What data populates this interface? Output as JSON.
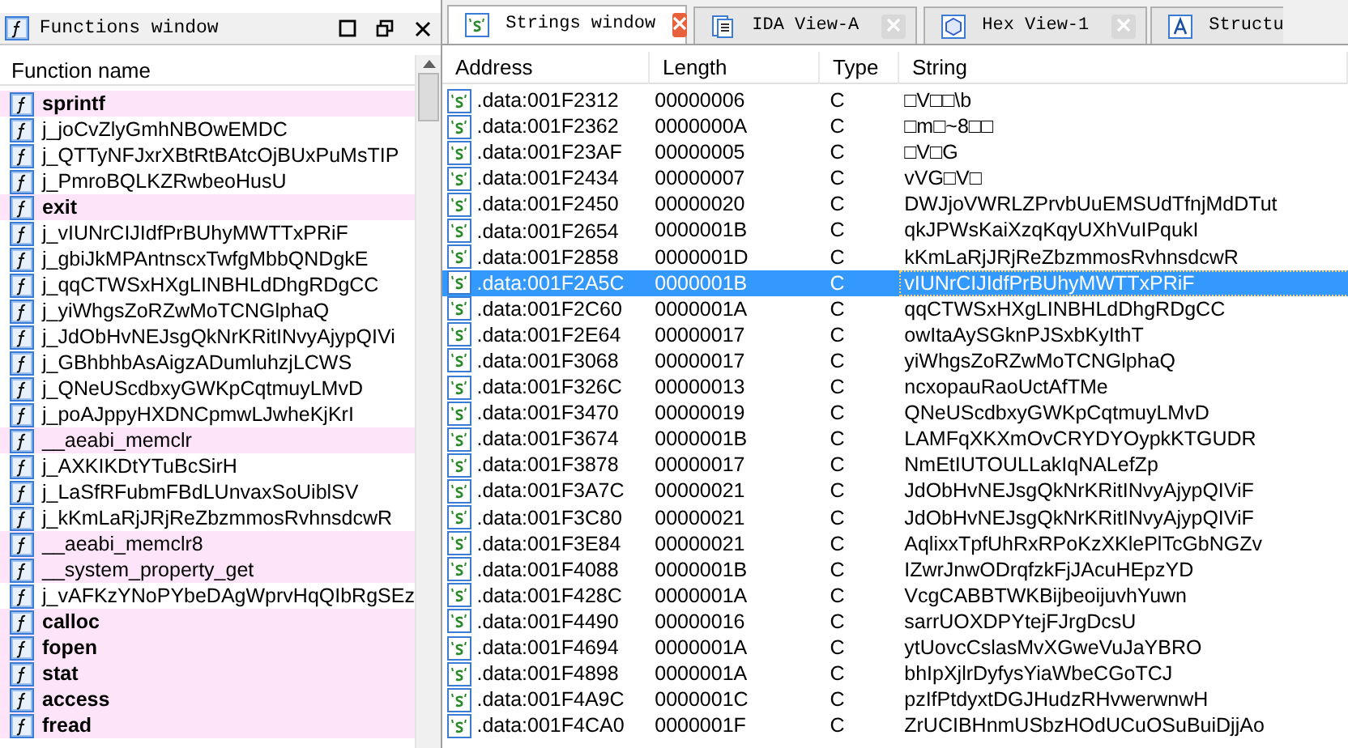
{
  "functions_window": {
    "title": "Functions window",
    "column": "Function name",
    "functions": [
      {
        "name": "sprintf",
        "kind": "import"
      },
      {
        "name": "j_joCvZlyGmhNBOwEMDC",
        "kind": "regular"
      },
      {
        "name": "j_QTTyNFJxrXBtRtBAtcOjBUxPuMsTIP",
        "kind": "regular"
      },
      {
        "name": "j_PmroBQLKZRwbeoHusU",
        "kind": "regular"
      },
      {
        "name": "exit",
        "kind": "import"
      },
      {
        "name": "j_vIUNrCIJIdfPrBUhyMWTTxPRiF",
        "kind": "regular"
      },
      {
        "name": "j_gbiJkMPAntnscxTwfgMbbQNDgkE",
        "kind": "regular"
      },
      {
        "name": "j_qqCTWSxHXgLINBHLdDhgRDgCC",
        "kind": "regular"
      },
      {
        "name": "j_yiWhgsZoRZwMoTCNGlphaQ",
        "kind": "regular"
      },
      {
        "name": "j_JdObHvNEJsgQkNrKRitINvyAjypQIVi",
        "kind": "regular"
      },
      {
        "name": "j_GBhbhbAsAigzADumluhzjLCWS",
        "kind": "regular"
      },
      {
        "name": "j_QNeUScdbxyGWKpCqtmuyLMvD",
        "kind": "regular"
      },
      {
        "name": "j_poAJppyHXDNCpmwLJwheKjKrI",
        "kind": "regular"
      },
      {
        "name": "__aeabi_memclr",
        "kind": "library"
      },
      {
        "name": "j_AXKIKDtYTuBcSirH",
        "kind": "regular"
      },
      {
        "name": "j_LaSfRFubmFBdLUnvaxSoUiblSV",
        "kind": "regular"
      },
      {
        "name": "j_kKmLaRjJRjReZbzmmosRvhnsdcwR",
        "kind": "regular"
      },
      {
        "name": "__aeabi_memclr8",
        "kind": "library"
      },
      {
        "name": "__system_property_get",
        "kind": "library"
      },
      {
        "name": "j_vAFKzYNoPYbeDAgWprvHqQIbRgSEz",
        "kind": "regular"
      },
      {
        "name": "calloc",
        "kind": "import"
      },
      {
        "name": "fopen",
        "kind": "import"
      },
      {
        "name": "stat",
        "kind": "import"
      },
      {
        "name": "access",
        "kind": "import"
      },
      {
        "name": "fread",
        "kind": "import"
      }
    ]
  },
  "tabs": [
    {
      "label": "Strings window",
      "kind": "strings",
      "selected": true
    },
    {
      "label": "IDA View-A",
      "kind": "disassembly",
      "selected": false
    },
    {
      "label": "Hex View-1",
      "kind": "hex",
      "selected": false
    },
    {
      "label": "Structu",
      "kind": "structures",
      "selected": false
    }
  ],
  "strings_table": {
    "columns": [
      "Address",
      "Length",
      "Type",
      "String"
    ],
    "rows": [
      {
        "address": ".data:001F2312",
        "length": "00000006",
        "type": "C",
        "string": "□V□□\\b",
        "selected": false
      },
      {
        "address": ".data:001F2362",
        "length": "0000000A",
        "type": "C",
        "string": "□m□~8□□",
        "selected": false
      },
      {
        "address": ".data:001F23AF",
        "length": "00000005",
        "type": "C",
        "string": "□V□G",
        "selected": false
      },
      {
        "address": ".data:001F2434",
        "length": "00000007",
        "type": "C",
        "string": "vVG□V□",
        "selected": false
      },
      {
        "address": ".data:001F2450",
        "length": "00000020",
        "type": "C",
        "string": "DWJjoVWRLZPrvbUuEMSUdTfnjMdDTut",
        "selected": false
      },
      {
        "address": ".data:001F2654",
        "length": "0000001B",
        "type": "C",
        "string": "qkJPWsKaiXzqKqyUXhVuIPqukI",
        "selected": false
      },
      {
        "address": ".data:001F2858",
        "length": "0000001D",
        "type": "C",
        "string": "kKmLaRjJRjReZbzmmosRvhnsdcwR",
        "selected": false
      },
      {
        "address": ".data:001F2A5C",
        "length": "0000001B",
        "type": "C",
        "string": "vIUNrCIJIdfPrBUhyMWTTxPRiF",
        "selected": true
      },
      {
        "address": ".data:001F2C60",
        "length": "0000001A",
        "type": "C",
        "string": "qqCTWSxHXgLINBHLdDhgRDgCC",
        "selected": false
      },
      {
        "address": ".data:001F2E64",
        "length": "00000017",
        "type": "C",
        "string": "owItaAySGknPJSxbKyIthT",
        "selected": false
      },
      {
        "address": ".data:001F3068",
        "length": "00000017",
        "type": "C",
        "string": "yiWhgsZoRZwMoTCNGlphaQ",
        "selected": false
      },
      {
        "address": ".data:001F326C",
        "length": "00000013",
        "type": "C",
        "string": "ncxopauRaoUctAfTMe",
        "selected": false
      },
      {
        "address": ".data:001F3470",
        "length": "00000019",
        "type": "C",
        "string": "QNeUScdbxyGWKpCqtmuyLMvD",
        "selected": false
      },
      {
        "address": ".data:001F3674",
        "length": "0000001B",
        "type": "C",
        "string": "LAMFqXKXmOvCRYDYOypkKTGUDR",
        "selected": false
      },
      {
        "address": ".data:001F3878",
        "length": "00000017",
        "type": "C",
        "string": "NmEtIUTOULLakIqNALefZp",
        "selected": false
      },
      {
        "address": ".data:001F3A7C",
        "length": "00000021",
        "type": "C",
        "string": "JdObHvNEJsgQkNrKRitINvyAjypQIViF",
        "selected": false
      },
      {
        "address": ".data:001F3C80",
        "length": "00000021",
        "type": "C",
        "string": "JdObHvNEJsgQkNrKRitINvyAjypQIViF",
        "selected": false
      },
      {
        "address": ".data:001F3E84",
        "length": "00000021",
        "type": "C",
        "string": "AqlixxTpfUhRxRPoKzXKlePlTcGbNGZv",
        "selected": false
      },
      {
        "address": ".data:001F4088",
        "length": "0000001B",
        "type": "C",
        "string": "IZwrJnwODrqfzkFjJAcuHEpzYD",
        "selected": false
      },
      {
        "address": ".data:001F428C",
        "length": "0000001A",
        "type": "C",
        "string": "VcgCABBTWKBijbeoijuvhYuwn",
        "selected": false
      },
      {
        "address": ".data:001F4490",
        "length": "00000016",
        "type": "C",
        "string": "sarrUOXDPYtejFJrgDcsU",
        "selected": false
      },
      {
        "address": ".data:001F4694",
        "length": "0000001A",
        "type": "C",
        "string": "ytUovcCslasMvXGweVuJaYBRO",
        "selected": false
      },
      {
        "address": ".data:001F4898",
        "length": "0000001A",
        "type": "C",
        "string": "bhIpXjlrDyfysYiaWbeCGoTCJ",
        "selected": false
      },
      {
        "address": ".data:001F4A9C",
        "length": "0000001C",
        "type": "C",
        "string": "pzIfPtdyxtDGJHudzRHvwerwnwH",
        "selected": false
      },
      {
        "address": ".data:001F4CA0",
        "length": "0000001F",
        "type": "C",
        "string": "ZrUCIBHnmUSbzHOdUCuOSuBuiDjjAo",
        "selected": false
      }
    ]
  }
}
